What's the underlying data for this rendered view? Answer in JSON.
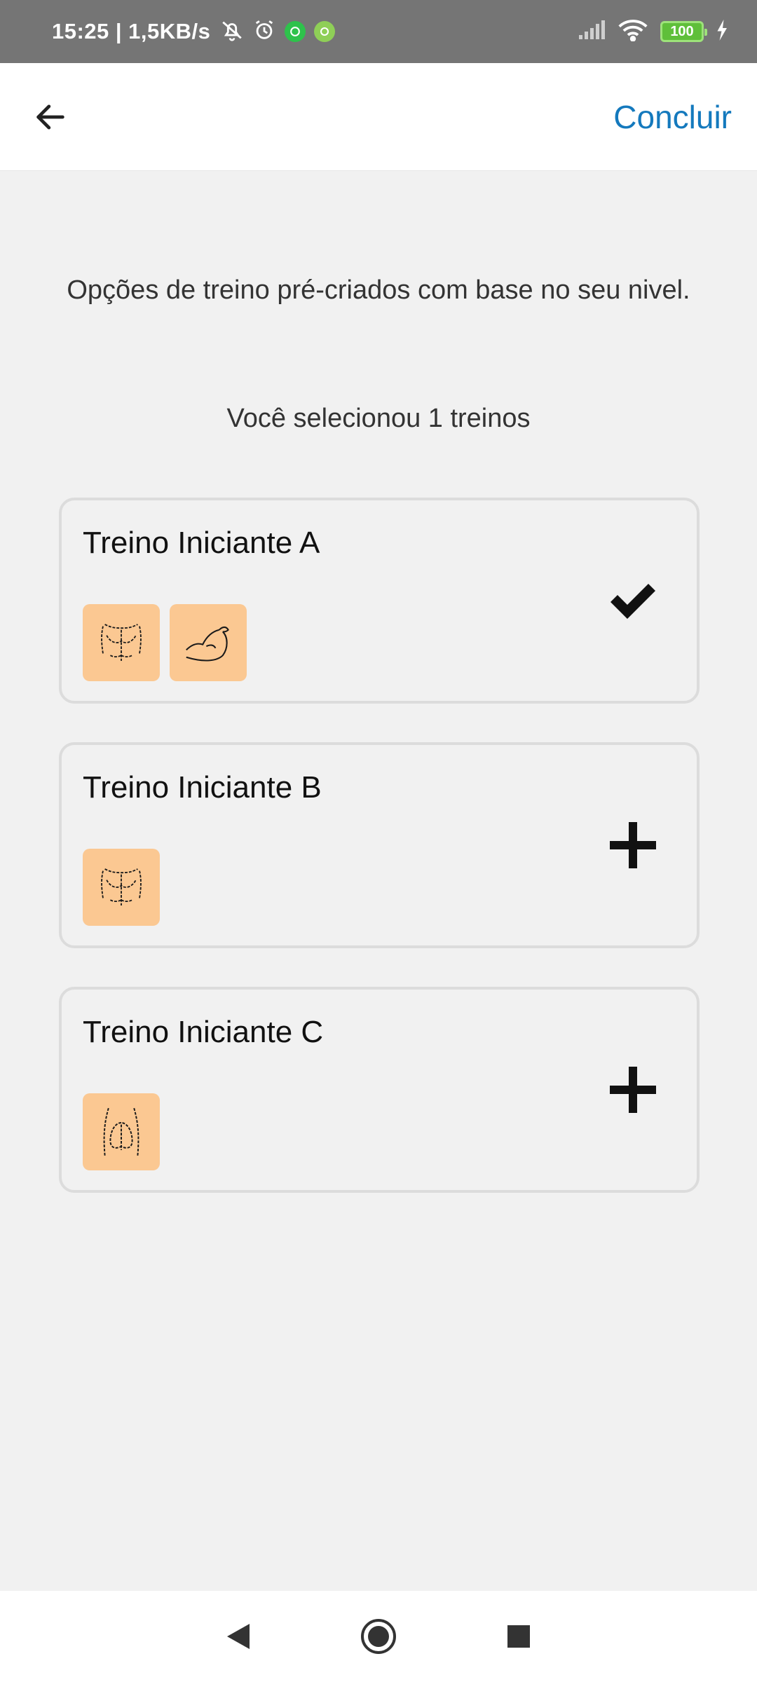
{
  "status_bar": {
    "time": "15:25 | 1,5KB/s",
    "battery": "100",
    "icons": [
      "mute-bell-icon",
      "alarm-icon",
      "whatsapp-icon",
      "settings-app-icon",
      "signal-icon",
      "wifi-icon",
      "battery-icon",
      "charging-icon"
    ]
  },
  "app_bar": {
    "back_icon": "arrow-left-icon",
    "done_label": "Concluir",
    "accent_color": "#1479bd"
  },
  "main": {
    "intro_text": "Opções de treino pré-criados com base no seu nivel.",
    "selected_text": "Você selecionou 1 treinos",
    "workouts": [
      {
        "title": "Treino Iniciante A",
        "state": "selected",
        "action_icon": "checkmark-icon",
        "muscle_icons": [
          "chest-icon",
          "biceps-icon"
        ]
      },
      {
        "title": "Treino Iniciante B",
        "state": "unselected",
        "action_icon": "plus-icon",
        "muscle_icons": [
          "chest-icon"
        ]
      },
      {
        "title": "Treino Iniciante C",
        "state": "unselected",
        "action_icon": "plus-icon",
        "muscle_icons": [
          "glutes-icon"
        ]
      }
    ],
    "thumb_color": "#fbc892"
  },
  "nav_bar": {
    "buttons": [
      "back-triangle-icon",
      "home-circle-icon",
      "recents-square-icon"
    ]
  }
}
